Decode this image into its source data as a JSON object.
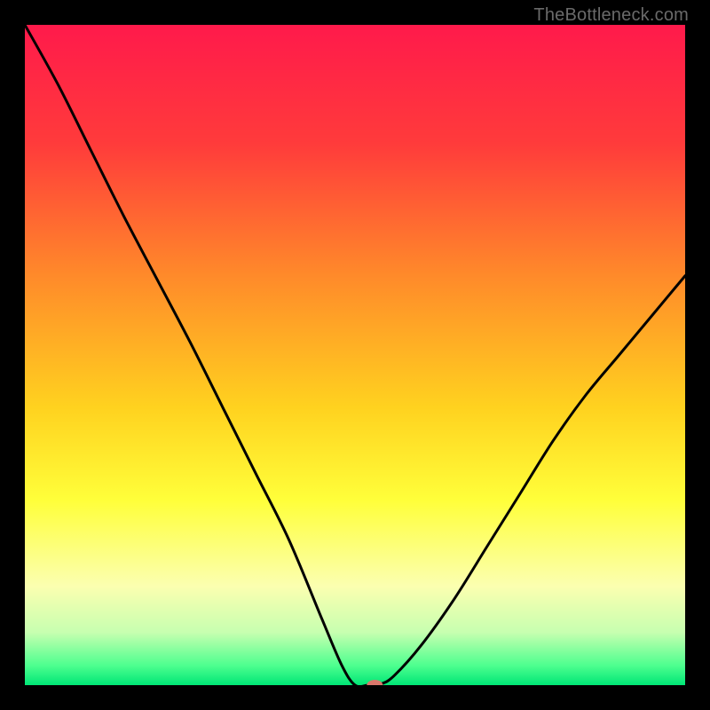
{
  "watermark": "TheBottleneck.com",
  "chart_data": {
    "type": "line",
    "title": "",
    "xlabel": "",
    "ylabel": "",
    "xlim": [
      0,
      100
    ],
    "ylim": [
      0,
      100
    ],
    "gradient_stops": [
      {
        "offset": 0,
        "color": "#ff1a4b"
      },
      {
        "offset": 18,
        "color": "#ff3b3b"
      },
      {
        "offset": 38,
        "color": "#ff8a2a"
      },
      {
        "offset": 58,
        "color": "#ffd21f"
      },
      {
        "offset": 72,
        "color": "#ffff3a"
      },
      {
        "offset": 85,
        "color": "#fbffb0"
      },
      {
        "offset": 92,
        "color": "#c7ffb0"
      },
      {
        "offset": 97,
        "color": "#4eff8f"
      },
      {
        "offset": 100,
        "color": "#00e676"
      }
    ],
    "series": [
      {
        "name": "bottleneck-curve",
        "x": [
          0,
          5,
          10,
          15,
          20,
          25,
          30,
          35,
          40,
          45,
          48,
          50,
          52,
          54,
          56,
          60,
          65,
          70,
          75,
          80,
          85,
          90,
          95,
          100
        ],
        "y": [
          100,
          91,
          81,
          71,
          61.5,
          52,
          42,
          32,
          22,
          10,
          3,
          0,
          0,
          0.2,
          1.5,
          6,
          13,
          21,
          29,
          37,
          44,
          50,
          56,
          62
        ]
      }
    ],
    "markers": [
      {
        "name": "current-point",
        "x": 53,
        "y": 0,
        "color": "#d9776b",
        "rx": 9,
        "ry": 6
      }
    ]
  }
}
